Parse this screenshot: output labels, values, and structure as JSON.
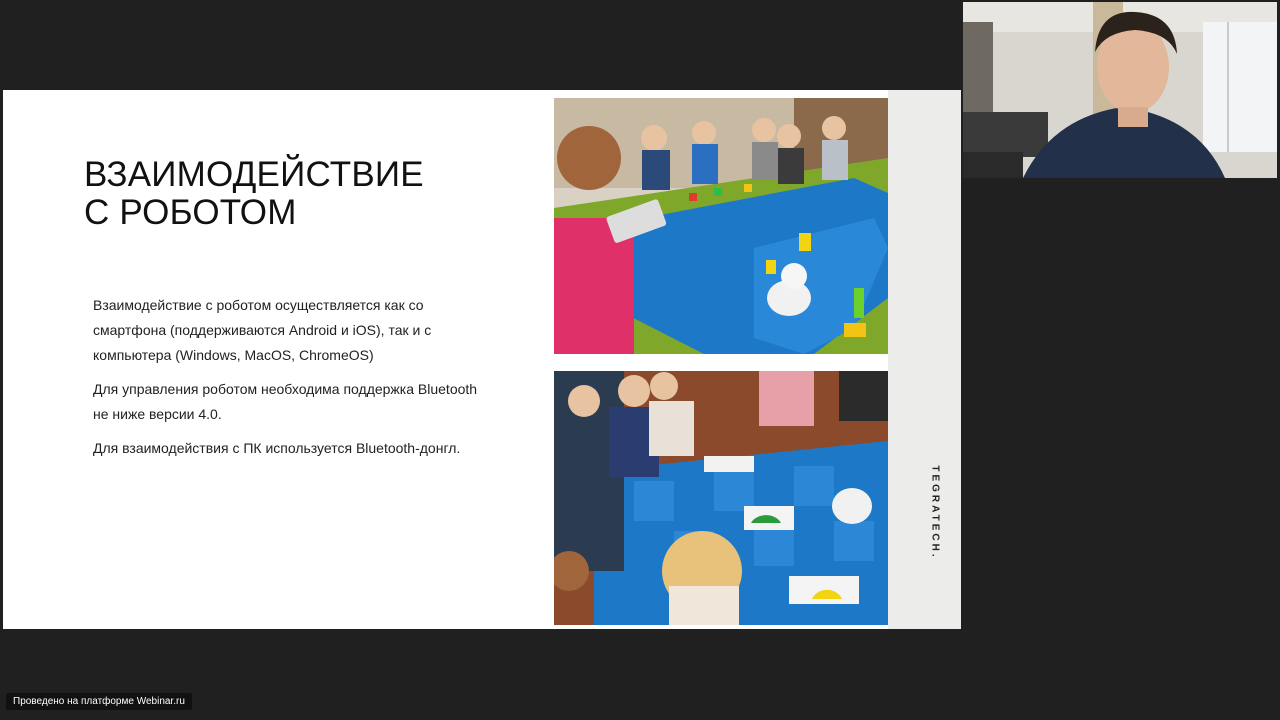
{
  "slide": {
    "title": "ВЗАИМОДЕЙСТВИЕ\nС РОБОТОМ",
    "paragraphs": [
      "Взаимодействие с роботом осуществляется как со смартфона (поддерживаются Android и iOS), так и с компьютера (Windows, MacOS, ChromeOS)",
      "Для управления роботом необходима поддержка Bluetooth не ниже версии 4.0.",
      "Для взаимодействия с ПК используется Bluetooth-донгл."
    ],
    "brand": "TEGRATECH."
  },
  "footer": {
    "platform_badge": "Проведено на платформе Webinar.ru"
  },
  "colors": {
    "background": "#202020",
    "slide": "#ffffff",
    "mat_blue": "#1e78c8",
    "grass_green": "#7fa82a"
  }
}
